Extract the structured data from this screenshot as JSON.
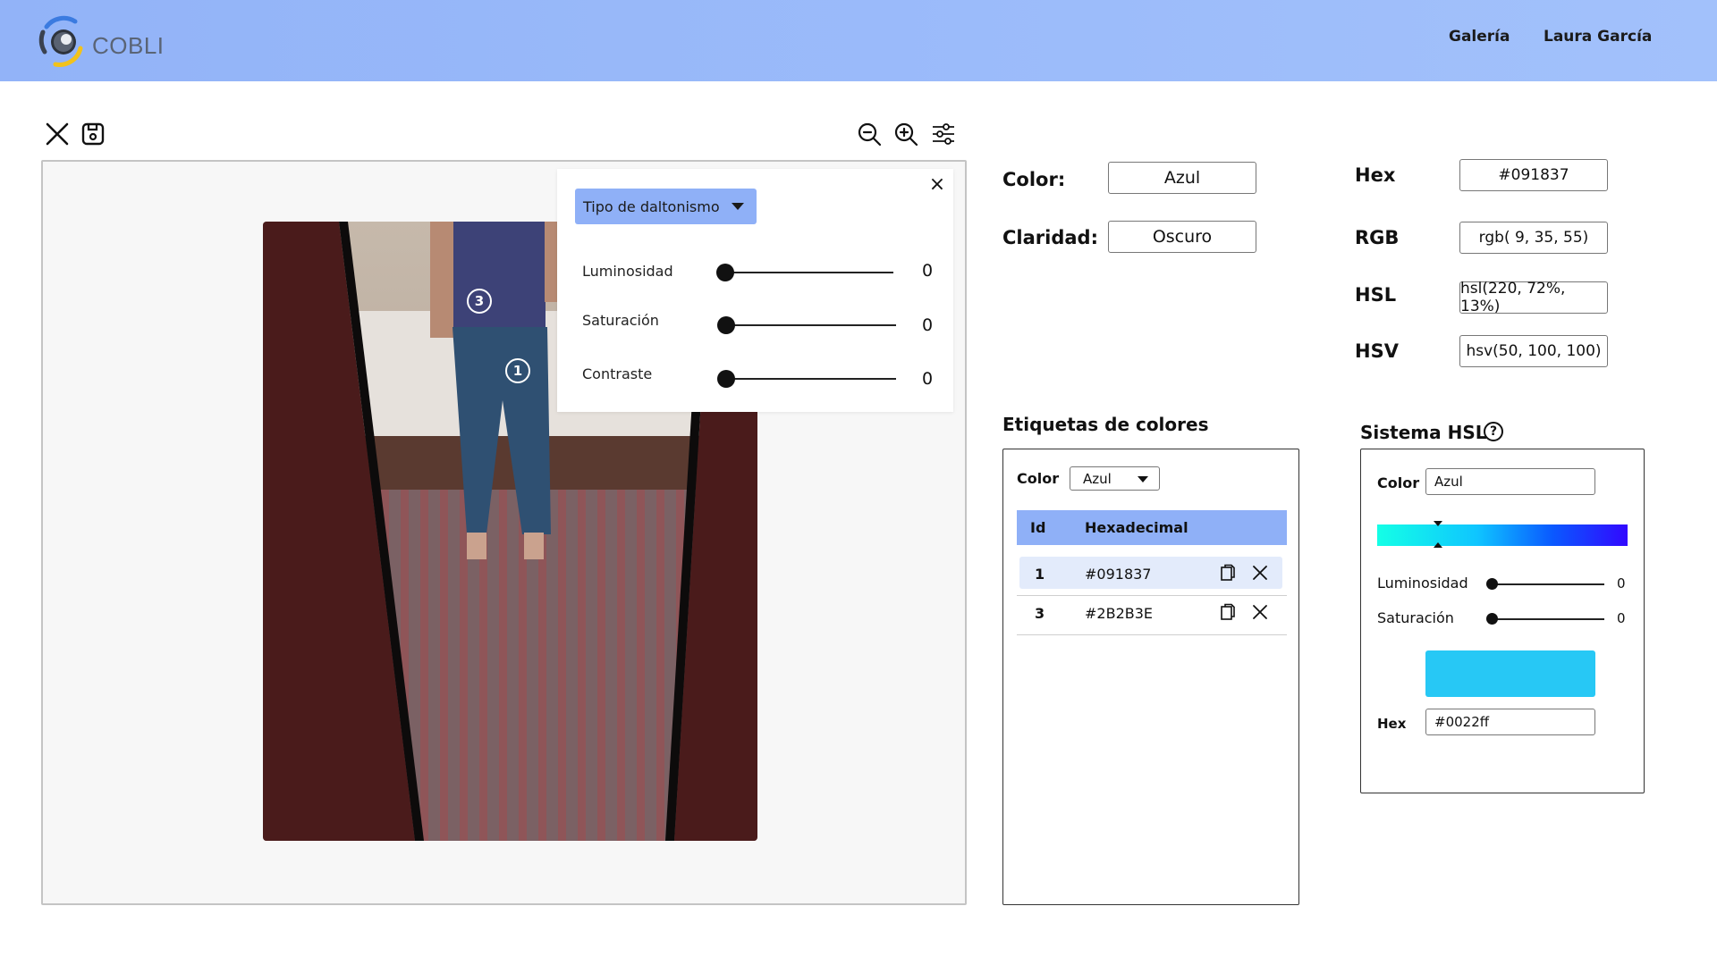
{
  "header": {
    "logo_text": "COBLI",
    "nav": {
      "gallery": "Galería",
      "user": "Laura García"
    }
  },
  "toolbar": {
    "left": [
      "close-icon",
      "save-icon"
    ],
    "right": [
      "zoom-out-icon",
      "zoom-in-icon",
      "sliders-icon"
    ]
  },
  "canvas": {
    "markers": [
      {
        "label": "3"
      },
      {
        "label": "1"
      }
    ]
  },
  "popup": {
    "dropdown_label": "Tipo de daltonismo",
    "close_glyph": "×",
    "sliders": [
      {
        "label": "Luminosidad",
        "value": "0"
      },
      {
        "label": "Saturación",
        "value": "0"
      },
      {
        "label": "Contraste",
        "value": "0"
      }
    ]
  },
  "info": {
    "color_label": "Color:",
    "color_value": "Azul",
    "clarity_label": "Claridad:",
    "clarity_value": "Oscuro",
    "hex_label": "Hex",
    "hex_value": "#091837",
    "rgb_label": "RGB",
    "rgb_value": "rgb( 9, 35, 55)",
    "hsl_label": "HSL",
    "hsl_value": "hsl(220, 72%, 13%)",
    "hsv_label": "HSV",
    "hsv_value": "hsv(50, 100, 100)"
  },
  "tags": {
    "title": "Etiquetas de colores",
    "color_label": "Color",
    "color_selected": "Azul",
    "columns": {
      "id": "Id",
      "hex": "Hexadecimal"
    },
    "rows": [
      {
        "id": "1",
        "hex": "#091837"
      },
      {
        "id": "3",
        "hex": "#2B2B3E"
      }
    ]
  },
  "hsl_system": {
    "title": "Sistema HSL",
    "help_glyph": "?",
    "color_label": "Color",
    "color_value": "Azul",
    "sliders": [
      {
        "label": "Luminosidad",
        "value": "0"
      },
      {
        "label": "Saturación",
        "value": "0"
      }
    ],
    "swatch_color": "#27c8f5",
    "hex_label": "Hex",
    "hex_value": "#0022ff"
  },
  "colors": {
    "accent": "#8fb0f7",
    "header_start": "#92b3f8",
    "header_end": "#a2c1fb",
    "selected_row": "#e3ebfb"
  }
}
